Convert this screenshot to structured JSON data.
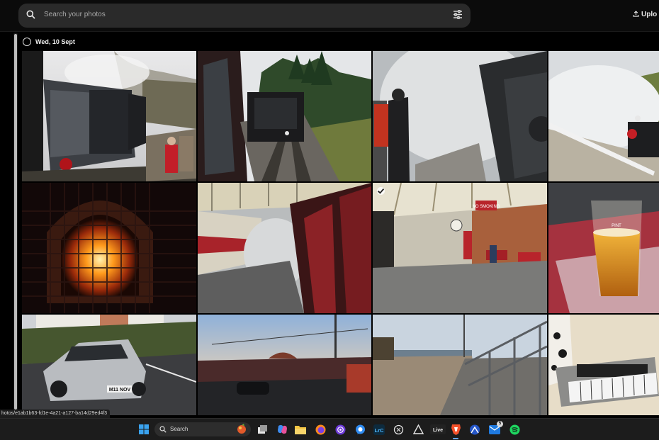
{
  "search": {
    "placeholder": "Search your photos"
  },
  "header": {
    "upload_label": "Uplo"
  },
  "section": {
    "date": "Wed, 10 Sept"
  },
  "photos": [
    {
      "row": 1,
      "col": 1,
      "subject": "steam-locomotive-at-platform"
    },
    {
      "row": 1,
      "col": 2,
      "subject": "train-on-track-from-window"
    },
    {
      "row": 1,
      "col": 3,
      "subject": "steam-engine-and-people"
    },
    {
      "row": 1,
      "col": 4,
      "subject": "steam-locomotive-smoke"
    },
    {
      "row": 2,
      "col": 1,
      "subject": "fireplace-grate"
    },
    {
      "row": 2,
      "col": 2,
      "subject": "station-platform-with-train"
    },
    {
      "row": 2,
      "col": 3,
      "subject": "station-concourse",
      "selected": true
    },
    {
      "row": 2,
      "col": 4,
      "subject": "pint-of-beer"
    },
    {
      "row": 3,
      "col": 1,
      "subject": "silver-sports-car"
    },
    {
      "row": 3,
      "col": 2,
      "subject": "seafront-sunset"
    },
    {
      "row": 3,
      "col": 3,
      "subject": "beach-promenade"
    },
    {
      "row": 3,
      "col": 4,
      "subject": "keyboard-synthesizer"
    }
  ],
  "photo_text": {
    "plate": "M11 NOV",
    "pint": "PINT",
    "no_smoking": "NO SMOKING"
  },
  "status_url": "hotos/e1ab1b63-fd1e-4a21-a127-ba14d29ed4f3",
  "taskbar": {
    "search_label": "Search",
    "apps": [
      "windows-start-icon",
      "task-view-icon",
      "copilot-icon",
      "file-explorer-icon",
      "firefox-icon",
      "podcast-icon",
      "messenger-icon",
      "lightroom-icon",
      "chatgpt-icon",
      "terminal-icon",
      "live-icon",
      "brave-icon",
      "nordvpn-icon",
      "mail-icon",
      "spotify-icon"
    ],
    "mail_badge": "5",
    "live_label": "Live",
    "lrc_label": "LrC"
  },
  "colors": {
    "background": "#000000",
    "search_bg": "#2a2a2a",
    "taskbar_bg": "#1c1c1c",
    "accent": "#6aa8ff"
  }
}
